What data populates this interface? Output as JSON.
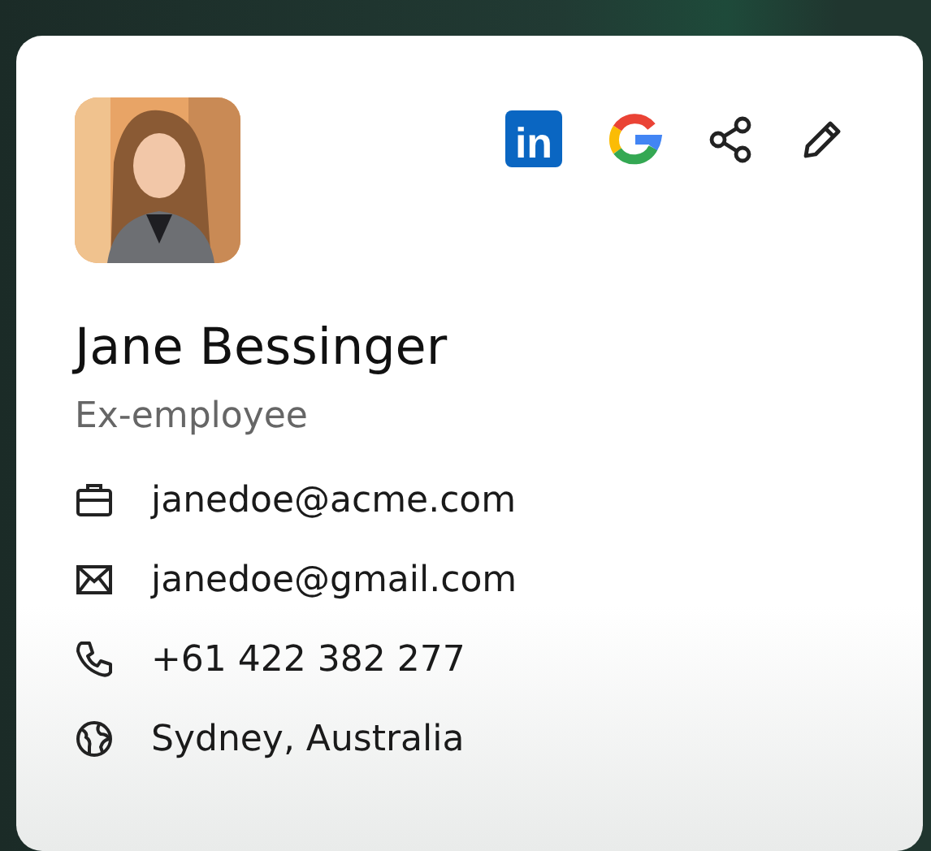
{
  "profile": {
    "name": "Jane Bessinger",
    "status": "Ex-employee"
  },
  "actions": [
    {
      "kind": "linkedin",
      "label": "in"
    },
    {
      "kind": "google"
    },
    {
      "kind": "share"
    },
    {
      "kind": "edit"
    }
  ],
  "contacts": [
    {
      "kind": "work",
      "text": "janedoe@acme.com"
    },
    {
      "kind": "email",
      "text": "janedoe@gmail.com"
    },
    {
      "kind": "phone",
      "text": "+61 422 382 277"
    },
    {
      "kind": "location",
      "text": "Sydney, Australia"
    }
  ]
}
